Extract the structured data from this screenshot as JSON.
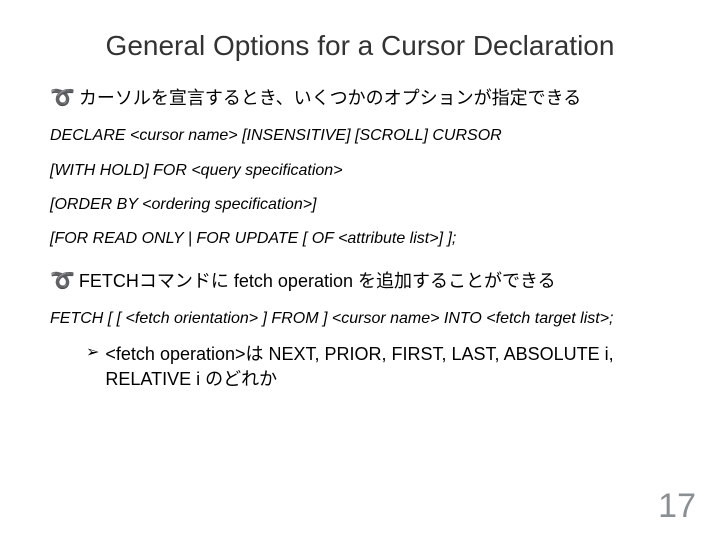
{
  "title": "General Options for a Cursor Declaration",
  "lines": {
    "b1": "カーソルを宣言するとき、いくつかのオプションが指定できる",
    "c1": "DECLARE <cursor name> [INSENSITIVE] [SCROLL] CURSOR",
    "c2": " [WITH HOLD] FOR <query specification>",
    "c3": "[ORDER BY <ordering specification>]",
    "c4": "[FOR READ ONLY | FOR UPDATE [ OF <attribute list>] ];",
    "b2": "FETCHコマンドに fetch operation を追加することができる",
    "c5": "FETCH [ [ <fetch orientation> ] FROM ] <cursor name> INTO <fetch target list>;",
    "s1": "<fetch operation>は NEXT, PRIOR, FIRST, LAST, ABSOLUTE i, RELATIVE i のどれか"
  },
  "page": "17"
}
